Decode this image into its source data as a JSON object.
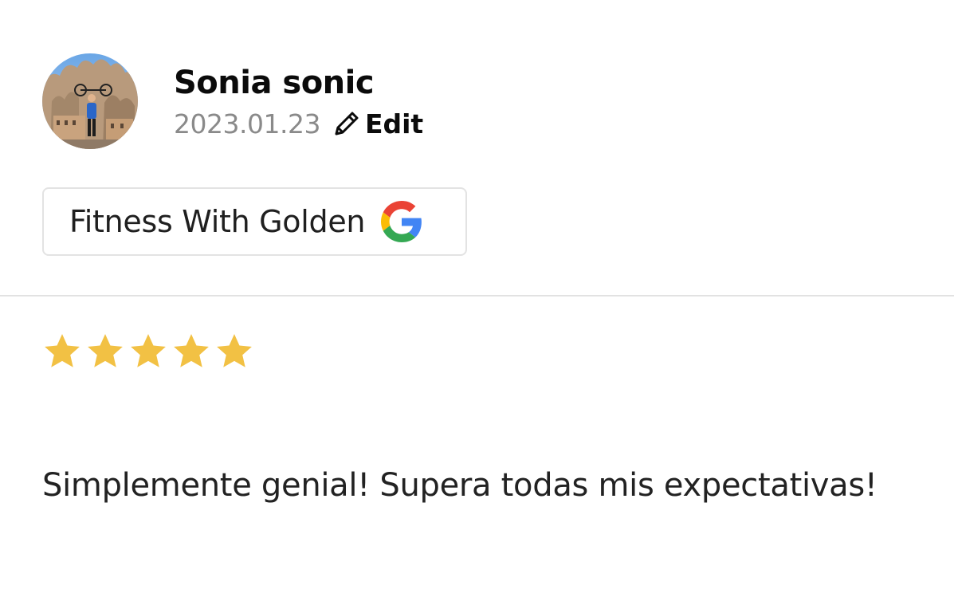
{
  "review": {
    "author_name": "Sonia sonic",
    "date": "2023.01.23",
    "edit_label": "Edit",
    "source_name": "Fitness With Golden",
    "source_icon": "google-icon",
    "rating": 5,
    "rating_max": 5,
    "text": "Simplemente genial! Supera todas mis expectativas!"
  },
  "colors": {
    "star": "#F2C144",
    "google_blue": "#4285F4",
    "google_red": "#EA4335",
    "google_yellow": "#FBBC05",
    "google_green": "#34A853",
    "divider": "#E2E2E2",
    "date": "#8A8A8A"
  }
}
